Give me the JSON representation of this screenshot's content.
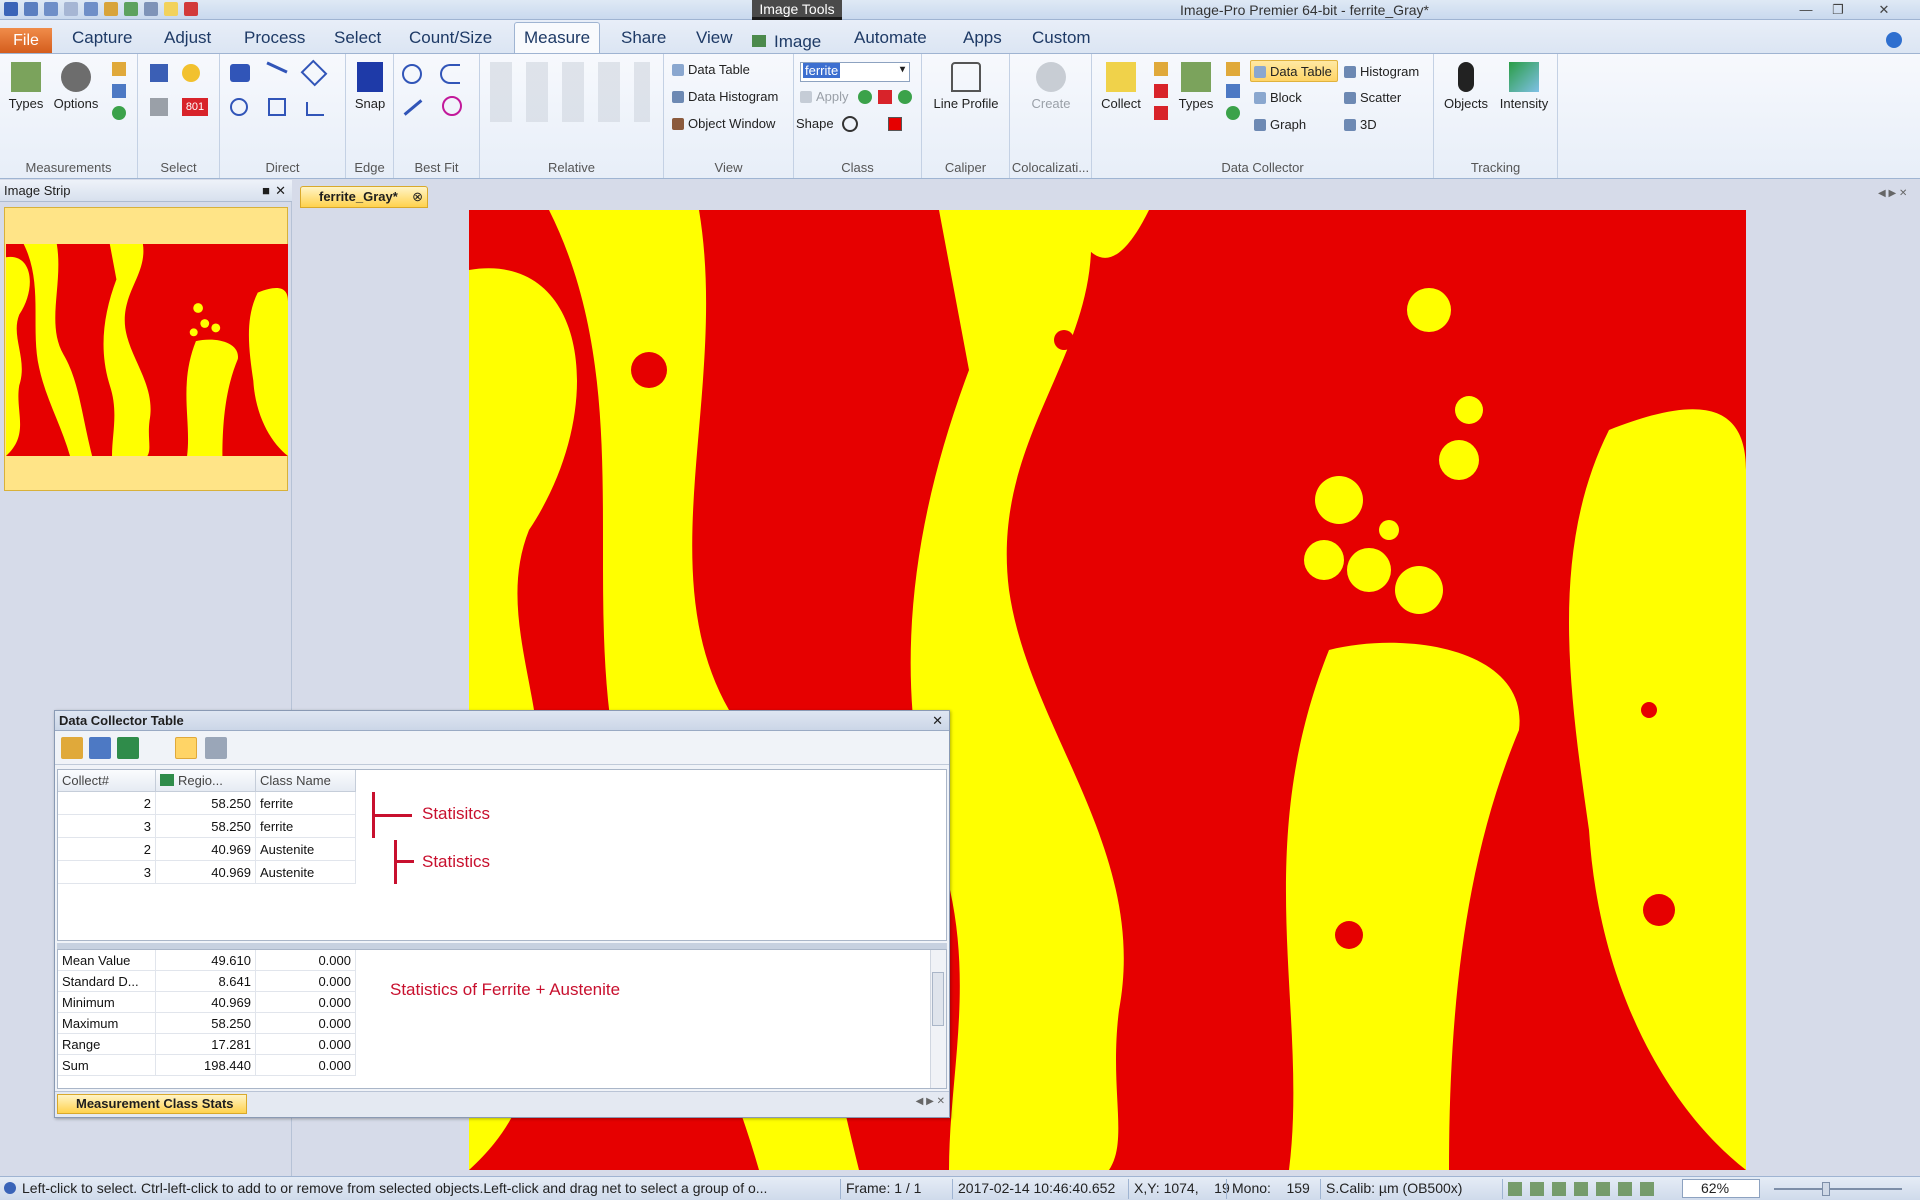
{
  "window": {
    "title": "Image-Pro Premier 64-bit - ferrite_Gray*",
    "context_tab_group": "Image Tools",
    "context_tab": "Image"
  },
  "menu": {
    "file": "File",
    "items": [
      "Capture",
      "Adjust",
      "Process",
      "Select",
      "Count/Size",
      "Measure",
      "Share",
      "View",
      "Automate",
      "Apps",
      "Custom"
    ]
  },
  "ribbon": {
    "measurements": {
      "label": "Measurements",
      "types": "Types",
      "options": "Options"
    },
    "select": {
      "label": "Select",
      "count": "801"
    },
    "direct": {
      "label": "Direct"
    },
    "edge": {
      "label": "Edge",
      "snap": "Snap"
    },
    "best_fit": {
      "label": "Best Fit"
    },
    "relative": {
      "label": "Relative"
    },
    "view": {
      "label": "View",
      "data_table": "Data Table",
      "data_histogram": "Data Histogram",
      "object_window": "Object Window"
    },
    "class": {
      "label": "Class",
      "value": "ferrite",
      "apply": "Apply",
      "shape": "Shape"
    },
    "caliper": {
      "label": "Caliper",
      "line_profile": "Line Profile"
    },
    "colocalization": {
      "label": "Colocalizati...",
      "create": "Create"
    },
    "data_collector": {
      "label": "Data Collector",
      "collect": "Collect",
      "types": "Types",
      "data_table": "Data Table",
      "block": "Block",
      "graph": "Graph",
      "histogram": "Histogram",
      "scatter": "Scatter",
      "three_d": "3D"
    },
    "tracking": {
      "label": "Tracking",
      "objects": "Objects",
      "intensity": "Intensity"
    }
  },
  "image_strip": {
    "title": "Image Strip"
  },
  "document": {
    "tab": "ferrite_Gray*"
  },
  "data_collector_table": {
    "title": "Data Collector Table",
    "columns": [
      "Collect#",
      "Regio...",
      "Class Name"
    ],
    "rows": [
      {
        "collect": "2",
        "region": "58.250",
        "class_name": "ferrite"
      },
      {
        "collect": "3",
        "region": "58.250",
        "class_name": "ferrite"
      },
      {
        "collect": "2",
        "region": "40.969",
        "class_name": "Austenite"
      },
      {
        "collect": "3",
        "region": "40.969",
        "class_name": "Austenite"
      }
    ],
    "stats": [
      {
        "name": "Mean Value",
        "v1": "49.610",
        "v2": "0.000"
      },
      {
        "name": "Standard D...",
        "v1": "8.641",
        "v2": "0.000"
      },
      {
        "name": "Minimum",
        "v1": "40.969",
        "v2": "0.000"
      },
      {
        "name": "Maximum",
        "v1": "58.250",
        "v2": "0.000"
      },
      {
        "name": "Range",
        "v1": "17.281",
        "v2": "0.000"
      },
      {
        "name": "Sum",
        "v1": "198.440",
        "v2": "0.000"
      }
    ],
    "annotations": {
      "a1": "Statisitcs",
      "a2": "Statistics",
      "a3": "Statistics of Ferrite + Austenite"
    },
    "bottom_tab": "Measurement Class Stats"
  },
  "status": {
    "hint": "Left-click to select.  Ctrl-left-click to add to or remove from selected objects.Left-click and drag net to select a group of o...",
    "frame": "Frame: 1 / 1",
    "timestamp": "2017-02-14 10:46:40.652",
    "xy": "X,Y: 1074,    19",
    "mono": "Mono:    159",
    "calib": "S.Calib: µm (OB500x)",
    "zoom": "62%"
  },
  "colors": {
    "ferrite_class": "#e60000",
    "phase_yellow": "#ffff00",
    "accent": "#ffd24d",
    "annotation": "#c8102e"
  }
}
